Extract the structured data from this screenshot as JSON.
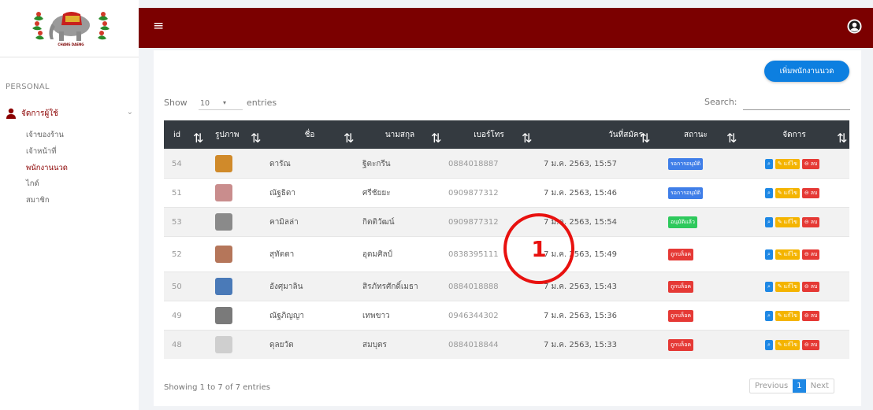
{
  "sidebar": {
    "section_label": "PERSONAL",
    "menu_label": "จัดการผู้ใช้",
    "submenu": [
      {
        "label": "เจ้าของร้าน",
        "active": false
      },
      {
        "label": "เจ้าหน้าที่",
        "active": false
      },
      {
        "label": "พนักงานนวด",
        "active": true
      },
      {
        "label": "ไกด์",
        "active": false
      },
      {
        "label": "สมาชิก",
        "active": false
      }
    ]
  },
  "topbar": {
    "menu_icon": "hamburger-icon",
    "user_icon": "user-circle-icon"
  },
  "toolbar": {
    "add_button_label": "เพิ่มพนักงานนวด",
    "show_label": "Show",
    "entries_value": "10",
    "entries_label": "entries",
    "search_label": "Search:",
    "search_value": ""
  },
  "table": {
    "headers": [
      "id",
      "รูปภาพ",
      "ชื่อ",
      "นามสกุล",
      "เบอร์โทร",
      "วันที่สมัคร",
      "สถานะ",
      "จัดการ"
    ],
    "rows": [
      {
        "id": "54",
        "first": "ดารัณ",
        "last": "ฐิตะกรีน",
        "phone": "0884018887",
        "date": "7 ม.ค. 2563, 15:57",
        "status": "รอการอนุมัติ",
        "status_color": "#3f7ee8",
        "photo": "#d08a2a"
      },
      {
        "id": "51",
        "first": "ณัฐธิดา",
        "last": "ศรีชัยยะ",
        "phone": "0909877312",
        "date": "7 ม.ค. 2563, 15:46",
        "status": "รอการอนุมัติ",
        "status_color": "#3f7ee8",
        "photo": "#c98d8d"
      },
      {
        "id": "53",
        "first": "คามิลล่า",
        "last": "กิตติวัฒน์",
        "phone": "0909877312",
        "date": "7 ม.ค. 2563, 15:54",
        "status": "อนุมัติแล้ว",
        "status_color": "#2ec95c",
        "photo": "#8a8a8a"
      },
      {
        "id": "52",
        "first": "สุทัตตา",
        "last": "อุดมศิลป์",
        "phone": "0838395111",
        "date": "7 ม.ค. 2563, 15:49",
        "status": "ถูกบล็อค",
        "status_color": "#e53935",
        "photo": "#b5765a"
      },
      {
        "id": "50",
        "first": "อังศุมาลิน",
        "last": "สิรภัทรศักดิ์เมธา",
        "phone": "0884018888",
        "date": "7 ม.ค. 2563, 15:43",
        "status": "ถูกบล็อค",
        "status_color": "#e53935",
        "photo": "#4a7ab8"
      },
      {
        "id": "49",
        "first": "ณัฐภิญญา",
        "last": "เทพขาว",
        "phone": "0946344302",
        "date": "7 ม.ค. 2563, 15:36",
        "status": "ถูกบล็อค",
        "status_color": "#e53935",
        "photo": "#7a7a7a"
      },
      {
        "id": "48",
        "first": "ดุลยวัต",
        "last": "สมบุตร",
        "phone": "0884018844",
        "date": "7 ม.ค. 2563, 15:33",
        "status": "ถูกบล็อค",
        "status_color": "#e53935",
        "photo": "#cfcfcf"
      }
    ],
    "actions": {
      "view_icon": "search-icon",
      "edit_label": "แก้ไข",
      "delete_label": "ลบ"
    }
  },
  "footer": {
    "info": "Showing 1 to 7 of 7 entries",
    "prev": "Previous",
    "page": "1",
    "next": "Next"
  },
  "annotation": {
    "label": "1",
    "color": "#e8110f"
  },
  "colors": {
    "topbar": "#7b0000",
    "accent": "#0d7fe0",
    "table_header": "#343a40"
  }
}
